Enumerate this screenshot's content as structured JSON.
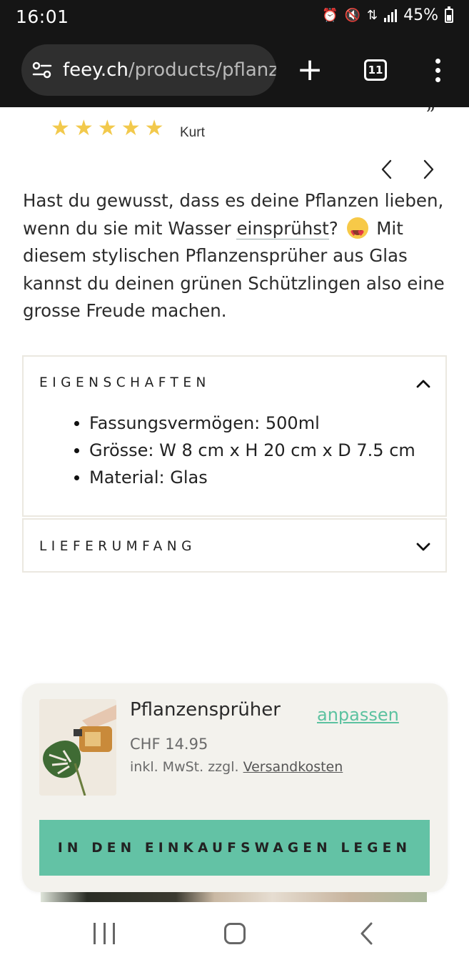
{
  "status_bar": {
    "time": "16:01",
    "battery": "45%",
    "icons": [
      "alarm-icon",
      "mute-icon",
      "data-transfer-icon",
      "signal-icon",
      "battery-icon"
    ]
  },
  "browser": {
    "url_domain": "feey.ch",
    "url_path": "/products/pflanze",
    "tab_count": "11",
    "icons": [
      "site-settings-icon",
      "plus-icon",
      "tabs-icon",
      "more-vert-icon"
    ]
  },
  "review": {
    "rating": 5,
    "stars": [
      "★",
      "★",
      "★",
      "★",
      "★"
    ],
    "reviewer": "Kurt",
    "quote_mark": "„"
  },
  "description": {
    "part1": "Hast du gewusst, dass es deine Pflanzen lieben, wenn du sie mit Wasser ",
    "link": "einsprühst",
    "part2": "? ",
    "part3": " Mit diesem stylischen Pflanzensprüher aus Glas kannst du deinen grünen Schützlingen also eine grosse Freude machen.",
    "emoji": "star-struck-emoji"
  },
  "accordion": {
    "properties": {
      "title": "EIGENSCHAFTEN",
      "expanded": true,
      "items": [
        "Fassungsvermögen: 500ml",
        "Grösse: W 8 cm x H 20 cm x D 7.5 cm",
        "Material: Glas"
      ]
    },
    "scope_of_delivery": {
      "title": "LIEFERUMFANG",
      "expanded": false
    }
  },
  "sticky_cart": {
    "product_name": "Pflanzensprüher",
    "adjust_label": "anpassen",
    "price": "CHF 14.95",
    "tax_note": "inkl. MwSt. zzgl. ",
    "shipping_link": "Versandkosten",
    "button_label": "IN DEN EINKAUFSWAGEN LEGEN",
    "colors": {
      "button": "#63c2a5",
      "link": "#5cc2a0",
      "background": "#f3f2ed"
    }
  },
  "nav_bar": {
    "icons": [
      "recents-icon",
      "home-icon",
      "back-icon"
    ]
  }
}
